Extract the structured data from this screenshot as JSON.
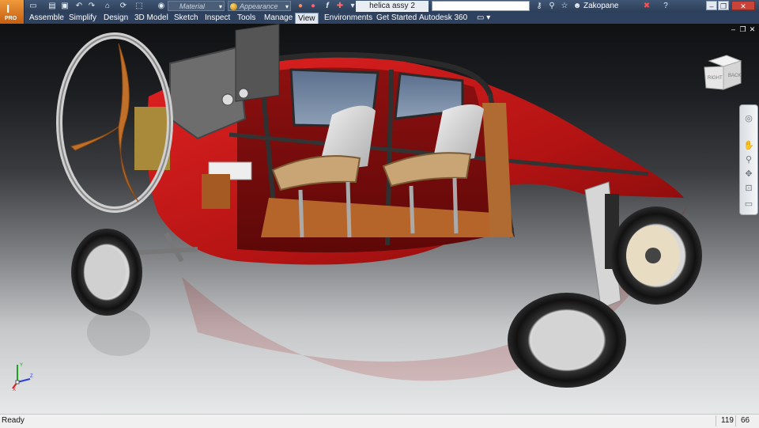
{
  "app": {
    "logo_letter": "I",
    "edition": "PRO"
  },
  "quick_access": {
    "icons": [
      "new-file-icon",
      "open-icon",
      "save-icon",
      "undo-icon",
      "redo-icon",
      "home-icon",
      "update-icon",
      "select-icon",
      "material-icon"
    ],
    "material_placeholder": "Material",
    "appearance_placeholder": "Appearance",
    "tools_icons": [
      "clear-appearance-icon",
      "adjust-appearance-icon",
      "fx-parameters-icon",
      "measure-icon",
      "add-icon"
    ]
  },
  "document_title": "helica assy 2",
  "help": {
    "search_value": "",
    "icons": [
      "key-icon",
      "search-icon",
      "star-icon",
      "user-icon"
    ],
    "user_name": "Zakopane",
    "exchange_icon": "exchange-icon",
    "help_icon": "help-icon"
  },
  "window_controls": [
    "minimize",
    "restore",
    "close"
  ],
  "ribbon": {
    "tabs": [
      {
        "label": "Assemble"
      },
      {
        "label": "Simplify"
      },
      {
        "label": "Design"
      },
      {
        "label": "3D Model"
      },
      {
        "label": "Sketch"
      },
      {
        "label": "Inspect"
      },
      {
        "label": "Tools"
      },
      {
        "label": "Manage"
      },
      {
        "label": "View",
        "active": true
      },
      {
        "label": "Environments"
      },
      {
        "label": "Get Started"
      },
      {
        "label": "Autodesk 360"
      }
    ],
    "panel_toggle_icon": "ribbon-toggle-icon"
  },
  "viewcube": {
    "face_right": "RIGHT",
    "face_back": "BACK"
  },
  "navigation_bar": {
    "items": [
      "steering-wheel-icon",
      "pan-icon",
      "zoom-icon",
      "orbit-icon",
      "look-at-icon",
      "nav-menu-icon"
    ]
  },
  "triad": {
    "axes": [
      "X",
      "Y",
      "Z"
    ],
    "colors": {
      "x": "#d22020",
      "y": "#1fa21f",
      "z": "#2a3fd8"
    }
  },
  "colors": {
    "body_red": "#c31a1a",
    "ribbon_dark": "#2e4260",
    "app_orange": "#e07a22"
  },
  "status": {
    "text": "Ready",
    "count_a": "119",
    "count_b": "66"
  }
}
